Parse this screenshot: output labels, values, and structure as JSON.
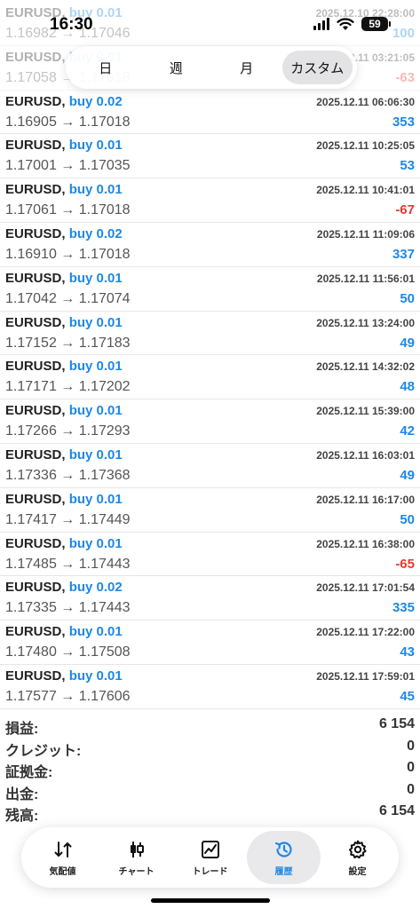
{
  "status_bar": {
    "time": "16:30",
    "battery": "59"
  },
  "period_tabs": [
    {
      "label": "日",
      "active": false
    },
    {
      "label": "週",
      "active": false
    },
    {
      "label": "月",
      "active": false
    },
    {
      "label": "カスタム",
      "active": true
    }
  ],
  "deals": [
    {
      "symbol": "EURUSD,",
      "side": "buy 0.01",
      "time": "2025.12.10 22:28:00",
      "prices": "1.16982 → 1.17046",
      "profit": "100",
      "faded": true
    },
    {
      "symbol": "EURUSD,",
      "side": "buy 0.01",
      "time": "2025.12.11 03:21:05",
      "prices": "1.17058 → 1.17018",
      "profit": "-63",
      "faded": true
    },
    {
      "symbol": "EURUSD,",
      "side": "buy 0.02",
      "time": "2025.12.11 06:06:30",
      "prices": "1.16905 → 1.17018",
      "profit": "353"
    },
    {
      "symbol": "EURUSD,",
      "side": "buy 0.01",
      "time": "2025.12.11 10:25:05",
      "prices": "1.17001 → 1.17035",
      "profit": "53"
    },
    {
      "symbol": "EURUSD,",
      "side": "buy 0.01",
      "time": "2025.12.11 10:41:01",
      "prices": "1.17061 → 1.17018",
      "profit": "-67"
    },
    {
      "symbol": "EURUSD,",
      "side": "buy 0.02",
      "time": "2025.12.11 11:09:06",
      "prices": "1.16910 → 1.17018",
      "profit": "337"
    },
    {
      "symbol": "EURUSD,",
      "side": "buy 0.01",
      "time": "2025.12.11 11:56:01",
      "prices": "1.17042 → 1.17074",
      "profit": "50"
    },
    {
      "symbol": "EURUSD,",
      "side": "buy 0.01",
      "time": "2025.12.11 13:24:00",
      "prices": "1.17152 → 1.17183",
      "profit": "49"
    },
    {
      "symbol": "EURUSD,",
      "side": "buy 0.01",
      "time": "2025.12.11 14:32:02",
      "prices": "1.17171 → 1.17202",
      "profit": "48"
    },
    {
      "symbol": "EURUSD,",
      "side": "buy 0.01",
      "time": "2025.12.11 15:39:00",
      "prices": "1.17266 → 1.17293",
      "profit": "42"
    },
    {
      "symbol": "EURUSD,",
      "side": "buy 0.01",
      "time": "2025.12.11 16:03:01",
      "prices": "1.17336 → 1.17368",
      "profit": "49"
    },
    {
      "symbol": "EURUSD,",
      "side": "buy 0.01",
      "time": "2025.12.11 16:17:00",
      "prices": "1.17417 → 1.17449",
      "profit": "50"
    },
    {
      "symbol": "EURUSD,",
      "side": "buy 0.01",
      "time": "2025.12.11 16:38:00",
      "prices": "1.17485 → 1.17443",
      "profit": "-65"
    },
    {
      "symbol": "EURUSD,",
      "side": "buy 0.02",
      "time": "2025.12.11 17:01:54",
      "prices": "1.17335 → 1.17443",
      "profit": "335"
    },
    {
      "symbol": "EURUSD,",
      "side": "buy 0.01",
      "time": "2025.12.11 17:22:00",
      "prices": "1.17480 → 1.17508",
      "profit": "43"
    },
    {
      "symbol": "EURUSD,",
      "side": "buy 0.01",
      "time": "2025.12.11 17:59:01",
      "prices": "1.17577 → 1.17606",
      "profit": "45"
    }
  ],
  "summary": [
    {
      "label": "損益:",
      "value": "6 154"
    },
    {
      "label": "クレジット:",
      "value": "0"
    },
    {
      "label": "証拠金:",
      "value": "0"
    },
    {
      "label": "出金:",
      "value": "0"
    },
    {
      "label": "残高:",
      "value": "6 154"
    }
  ],
  "nav": [
    {
      "label": "気配値",
      "icon": "quotes-arrows-icon",
      "active": false
    },
    {
      "label": "チャート",
      "icon": "candlestick-chart-icon",
      "active": false
    },
    {
      "label": "トレード",
      "icon": "trade-line-chart-icon",
      "active": false
    },
    {
      "label": "履歴",
      "icon": "history-clock-icon",
      "active": true
    },
    {
      "label": "設定",
      "icon": "settings-gear-icon",
      "active": false
    }
  ],
  "colors": {
    "accent": "#1e88e5",
    "loss": "#e53935"
  }
}
